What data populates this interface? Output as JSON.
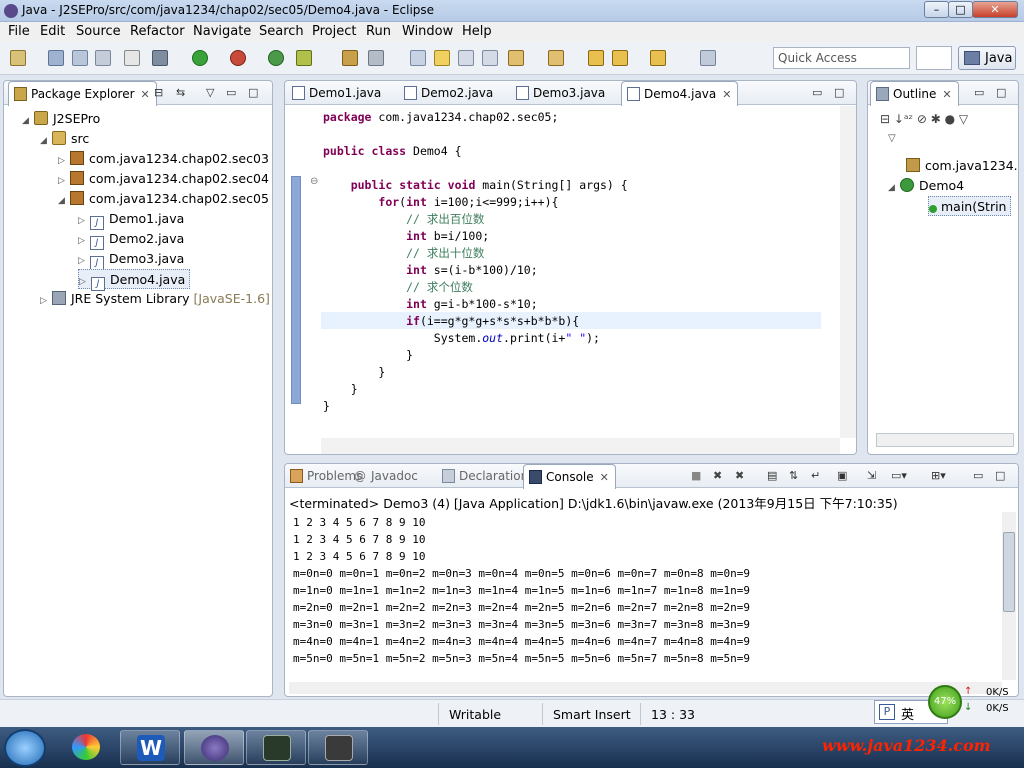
{
  "window": {
    "title": "Java - J2SEPro/src/com/java1234/chap02/sec05/Demo4.java - Eclipse",
    "minimize": "–",
    "maximize": "□",
    "close": "✕"
  },
  "menu": [
    "File",
    "Edit",
    "Source",
    "Refactor",
    "Navigate",
    "Search",
    "Project",
    "Run",
    "Window",
    "Help"
  ],
  "toolbar": {
    "quick_access_placeholder": "Quick Access",
    "perspective": "Java"
  },
  "package_explorer": {
    "title": "Package Explorer",
    "items": [
      {
        "label": "J2SEPro",
        "icon": "project-icon"
      },
      {
        "label": "src",
        "icon": "source-folder-icon"
      },
      {
        "label": "com.java1234.chap02.sec03",
        "icon": "package-icon"
      },
      {
        "label": "com.java1234.chap02.sec04",
        "icon": "package-icon"
      },
      {
        "label": "com.java1234.chap02.sec05",
        "icon": "package-icon"
      },
      {
        "label": "Demo1.java",
        "icon": "java-file-icon"
      },
      {
        "label": "Demo2.java",
        "icon": "java-file-icon"
      },
      {
        "label": "Demo3.java",
        "icon": "java-file-icon"
      },
      {
        "label": "Demo4.java",
        "icon": "java-file-icon"
      },
      {
        "label": "JRE System Library",
        "icon": "library-icon",
        "suffix": "[JavaSE-1.6]"
      }
    ]
  },
  "editor": {
    "tabs": [
      "Demo1.java",
      "Demo2.java",
      "Demo3.java",
      "Demo4.java"
    ],
    "active_tab": "Demo4.java",
    "lines": [
      {
        "a": "package com.java1234.chap02.sec05;"
      },
      {
        "a": ""
      },
      {
        "a": "public class Demo4 {"
      },
      {
        "a": ""
      },
      {
        "a": "    public static void main(String[] args) {"
      },
      {
        "a": "        for(int i=100;i<=999;i++){"
      },
      {
        "a": "            // 求出百位数"
      },
      {
        "a": "            int b=i/100;"
      },
      {
        "a": "            // 求出十位数"
      },
      {
        "a": "            int s=(i-b*100)/10;"
      },
      {
        "a": "            // 求个位数"
      },
      {
        "a": "            int g=i-b*100-s*10;"
      },
      {
        "a": "            if(i==g*g*g+s*s*s+b*b*b){"
      },
      {
        "a": "                System.out.print(i+\" \");"
      },
      {
        "a": "            }"
      },
      {
        "a": "        }"
      },
      {
        "a": "    }"
      },
      {
        "a": "}"
      }
    ]
  },
  "outline": {
    "title": "Outline",
    "items": [
      {
        "label": "com.java1234.",
        "icon": "import-icon"
      },
      {
        "label": "Demo4",
        "icon": "class-icon"
      },
      {
        "label": "main(Strin",
        "icon": "method-icon"
      }
    ]
  },
  "console": {
    "tabs": [
      "Problems",
      "Javadoc",
      "Declaration",
      "Console"
    ],
    "active_tab": "Console",
    "header": "<terminated> Demo3 (4) [Java Application] D:\\jdk1.6\\bin\\javaw.exe (2013年9月15日 下午7:10:35)",
    "lines": [
      "1 2 3 4 5 6 7 8 9 10",
      "1 2 3 4 5 6 7 8 9 10",
      "1 2 3 4 5 6 7 8 9 10",
      "m=0n=0 m=0n=1 m=0n=2 m=0n=3 m=0n=4 m=0n=5 m=0n=6 m=0n=7 m=0n=8 m=0n=9",
      "m=1n=0 m=1n=1 m=1n=2 m=1n=3 m=1n=4 m=1n=5 m=1n=6 m=1n=7 m=1n=8 m=1n=9",
      "m=2n=0 m=2n=1 m=2n=2 m=2n=3 m=2n=4 m=2n=5 m=2n=6 m=2n=7 m=2n=8 m=2n=9",
      "m=3n=0 m=3n=1 m=3n=2 m=3n=3 m=3n=4 m=3n=5 m=3n=6 m=3n=7 m=3n=8 m=3n=9",
      "m=4n=0 m=4n=1 m=4n=2 m=4n=3 m=4n=4 m=4n=5 m=4n=6 m=4n=7 m=4n=8 m=4n=9",
      "m=5n=0 m=5n=1 m=5n=2 m=5n=3 m=5n=4 m=5n=5 m=5n=6 m=5n=7 m=5n=8 m=5n=9"
    ]
  },
  "statusbar": {
    "mode": "Writable",
    "insert": "Smart Insert",
    "position": "13 : 33"
  },
  "tray": {
    "ime": "英",
    "cpu": "47%",
    "up": "0K/S",
    "down": "0K/S"
  },
  "watermark": "www.java1234.com"
}
